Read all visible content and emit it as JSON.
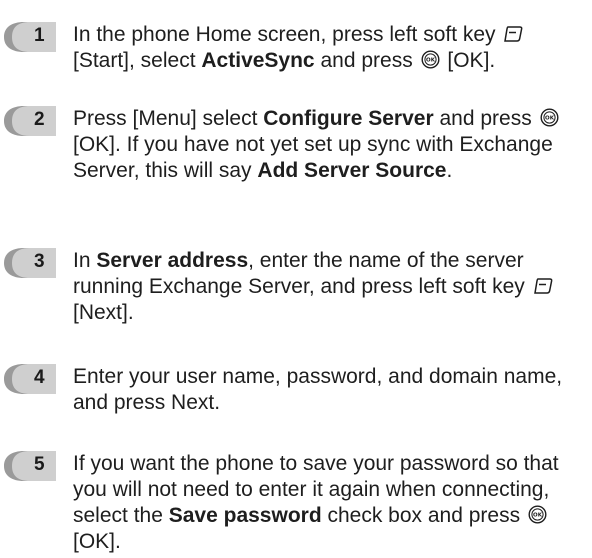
{
  "steps": [
    {
      "number": "1",
      "p1": "In the phone Home screen, press left soft key",
      "p2": "[Start], select",
      "b1": "ActiveSync",
      "p3": "and press",
      "p4": "[OK]."
    },
    {
      "number": "2",
      "p1": "Press [Menu] select",
      "b1": "Configure Server",
      "p2": "and press",
      "p3": "[OK]. If you have not yet set up sync with Exchange Server, this will say",
      "b2": "Add Server Source",
      "p4": "."
    },
    {
      "number": "3",
      "p1": "In",
      "b1": "Server address",
      "p2": ", enter the name of the server running Exchange Server, and press left soft key",
      "p3": "[Next]."
    },
    {
      "number": "4",
      "p1": "Enter your user name, password, and domain name, and press Next."
    },
    {
      "number": "5",
      "p1": "If you want the phone to save your password so that you will not need to enter it again when connecting, select the",
      "b1": "Save password",
      "p2": "check box and press",
      "p3": "[OK]."
    }
  ],
  "icons": {
    "soft_key": "left-soft-key-icon",
    "ok_key": "ok-key-icon"
  }
}
